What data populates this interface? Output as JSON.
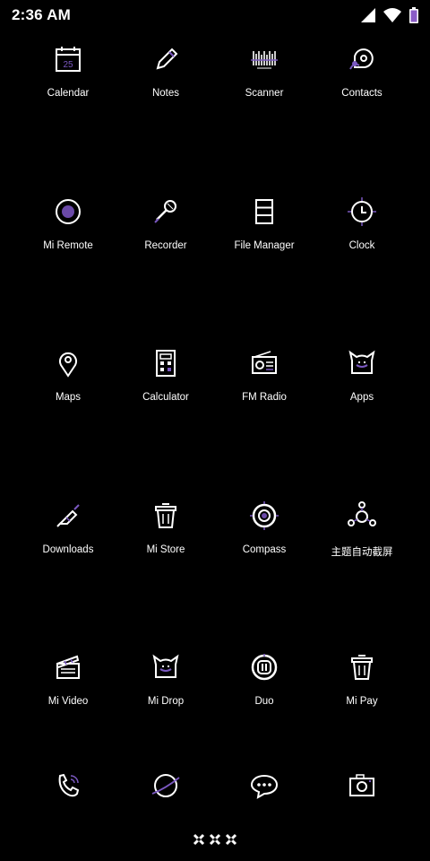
{
  "status_bar": {
    "time": "2:36 AM",
    "icons": [
      "signal-icon",
      "wifi-icon",
      "battery-icon"
    ],
    "battery_color": "#8a5cc7"
  },
  "accent_color": "#6b4aa8",
  "apps": [
    {
      "label": "Calendar",
      "icon": "calendar-icon",
      "calendar_day": "25"
    },
    {
      "label": "Notes",
      "icon": "pencil-icon"
    },
    {
      "label": "Scanner",
      "icon": "scanner-icon"
    },
    {
      "label": "Contacts",
      "icon": "contacts-icon"
    },
    {
      "label": "Mi Remote",
      "icon": "remote-icon"
    },
    {
      "label": "Recorder",
      "icon": "microphone-icon"
    },
    {
      "label": "File Manager",
      "icon": "file-cabinet-icon"
    },
    {
      "label": "Clock",
      "icon": "clock-icon"
    },
    {
      "label": "Maps",
      "icon": "map-pin-icon"
    },
    {
      "label": "Calculator",
      "icon": "calculator-icon"
    },
    {
      "label": "FM Radio",
      "icon": "radio-icon"
    },
    {
      "label": "Apps",
      "icon": "mi-bunny-icon"
    },
    {
      "label": "Downloads",
      "icon": "download-icon"
    },
    {
      "label": "Mi Store",
      "icon": "trash-bin-icon"
    },
    {
      "label": "Compass",
      "icon": "compass-icon"
    },
    {
      "label": "主题自动截屏",
      "icon": "share-nodes-icon"
    },
    {
      "label": "Mi Video",
      "icon": "clapperboard-icon"
    },
    {
      "label": "Mi Drop",
      "icon": "mi-bunny-icon"
    },
    {
      "label": "Duo",
      "icon": "duo-icon"
    },
    {
      "label": "Mi Pay",
      "icon": "trash-bin-icon"
    }
  ],
  "dock": [
    {
      "icon": "phone-icon"
    },
    {
      "icon": "browser-planet-icon"
    },
    {
      "icon": "message-bubble-icon"
    },
    {
      "icon": "camera-icon"
    }
  ],
  "page_indicator": {
    "count": 3,
    "icon": "pager-dot-icon"
  }
}
